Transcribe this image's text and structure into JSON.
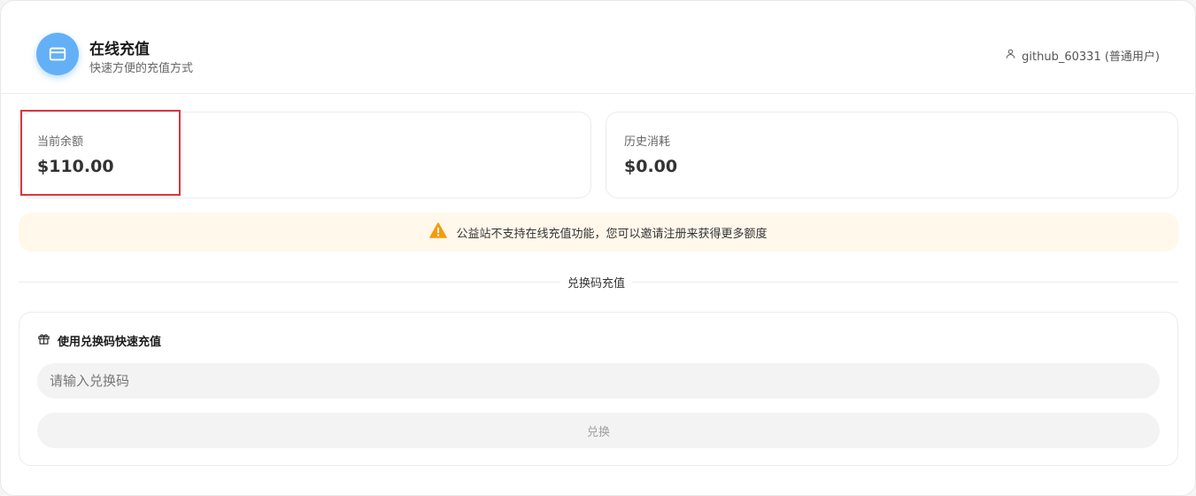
{
  "header": {
    "title": "在线充值",
    "subtitle": "快速方便的充值方式",
    "icon": "credit-card-icon",
    "user": "github_60331 (普通用户)"
  },
  "stats": {
    "balance_label": "当前余额",
    "balance_value": "$110.00",
    "history_label": "历史消耗",
    "history_value": "$0.00"
  },
  "notice": {
    "text": "公益站不支持在线充值功能，您可以邀请注册来获得更多额度",
    "icon": "warning-icon"
  },
  "redeem": {
    "section_title": "兑换码充值",
    "card_title": "使用兑换码快速充值",
    "input_placeholder": "请输入兑换码",
    "input_value": "",
    "button_label": "兑换"
  },
  "colors": {
    "accent": "#64b0f7",
    "warning": "#f59a0c",
    "notice_bg": "#fff8eb",
    "highlight": "#d9363e"
  }
}
